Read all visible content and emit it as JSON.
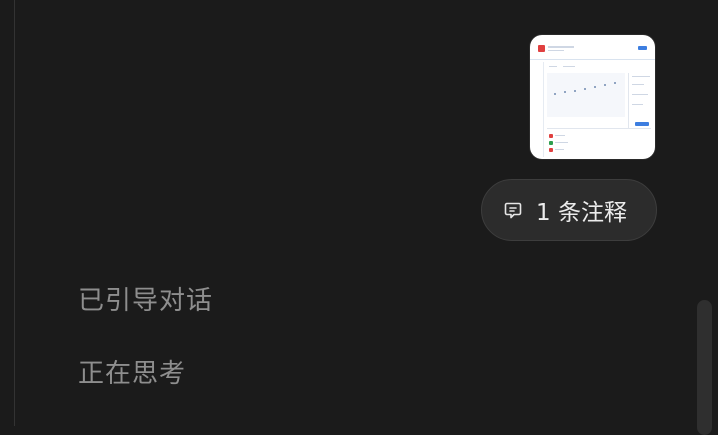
{
  "conversation": {
    "annotation_pill": {
      "label": "1 条注释",
      "icon": "comment-icon"
    },
    "status_lines": [
      "已引导对话",
      "正在思考"
    ]
  }
}
